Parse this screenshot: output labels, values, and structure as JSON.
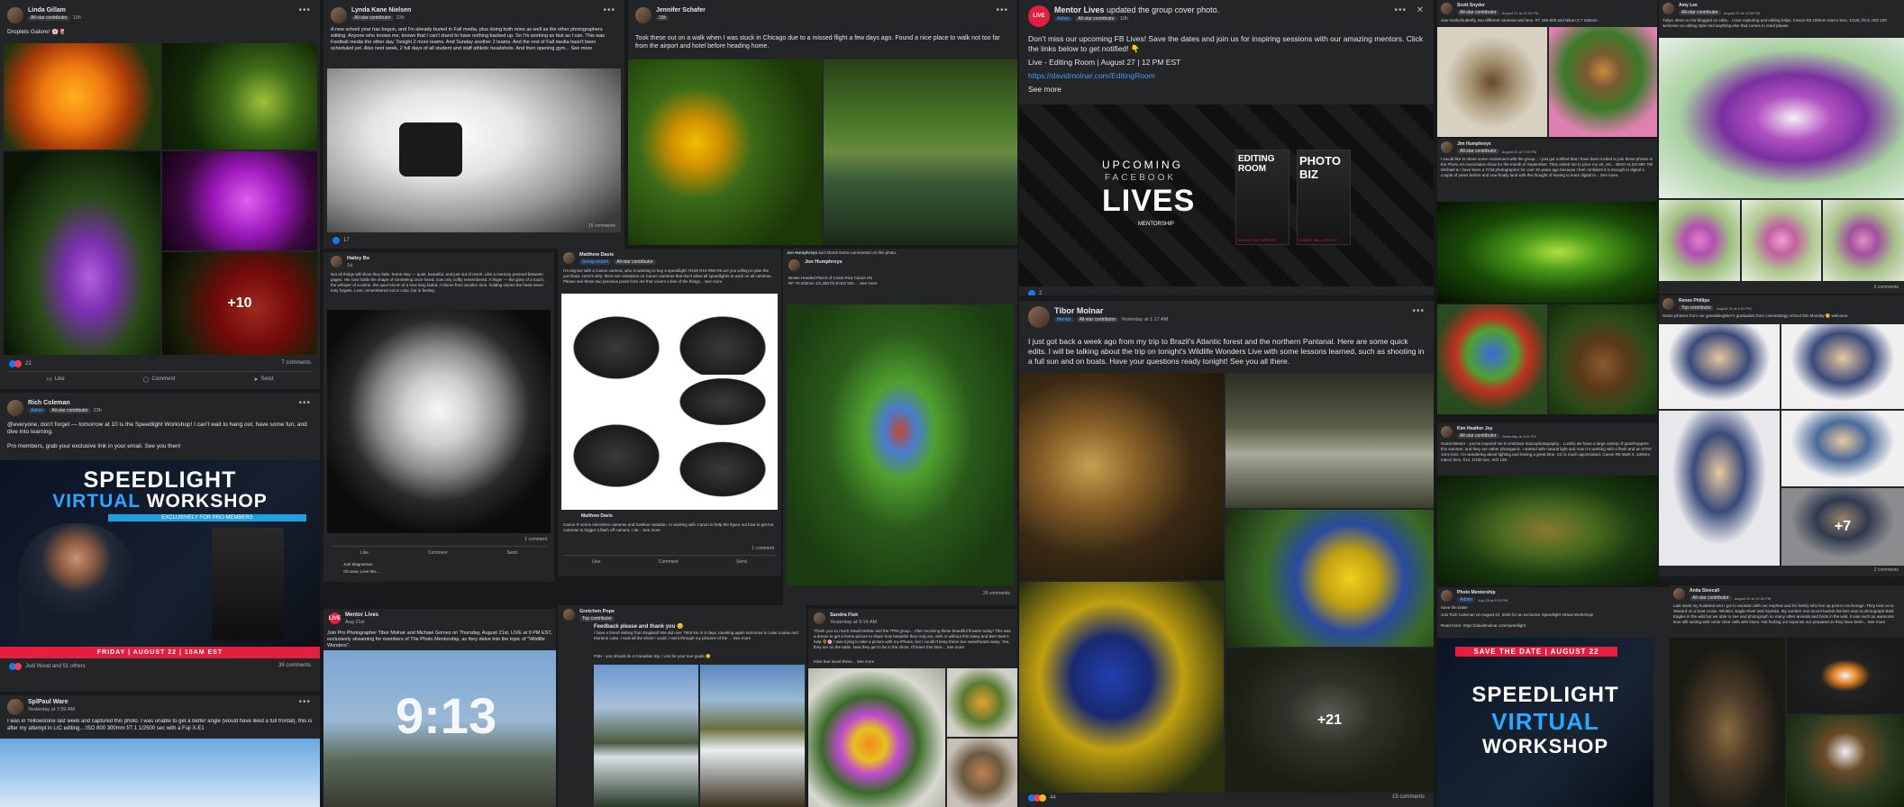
{
  "p1": {
    "name": "Linda Gillam",
    "badge": "All-star contributor",
    "time": "13h",
    "text": "Droplets Galore! 🌸🌷",
    "more": "+10",
    "reactions": "22",
    "comments": "7 comments",
    "like": "Like",
    "comment": "Comment",
    "send": "Send"
  },
  "p2": {
    "name": "Rich Coleman",
    "badge1": "Admin",
    "badge2": "All-star contributor",
    "time": "23h",
    "text1": "@everyone, don't forget — tomorrow at 10 is the Speedlight Workshop! I can't wait to hang out, have some fun, and dive into learning.",
    "text2": "Pro members, grab your exclusive link in your email. See you then!",
    "banner_l1": "SPEEDLIGHT",
    "banner_l2a": "VIRTUAL",
    "banner_l2b": "WORKSHOP",
    "banner_sub": "EXCLUSIVELY FOR PRO MEMBERS",
    "banner_date": "FRIDAY | AUGUST 22 | 10AM EST",
    "reactions": "Jodi Wood and 51 others",
    "comments": "38 comments"
  },
  "p3": {
    "name": "SplPaul Ware",
    "time": "Yesterday at 7:00 AM",
    "text": "I was in Yellowstone last week and captured this photo. I was unable to get a better angle (would have liked a full frontal), this is after my attempt in LrC editing... ISO 800 300mm f/7.1 1/2500 sec with a Fuji X-E1"
  },
  "p4": {
    "name": "Lynda Kane Nielsen",
    "badge": "All-star contributor",
    "time": "23h",
    "text": "A new school year has begun, and I'm already buried in Fall media, plus doing both mine as well as the other photographers editing. Anyone who knows me, knows that I can't stand to have nothing backed up. So I'm working as fast as I can. This was Football media the other day. Tonight 2 more teams. And Sunday another 2 teams. And the rest of Fall media hasn't been scheduled yet. Also next week, 2 full days of all student and staff athletic headshots. And then opening gym... See more",
    "comments": "15 comments",
    "reactions": "17"
  },
  "p5": {
    "name": "Hailey Bo",
    "time": "1d",
    "text": "Not all things will show they fade. Some stay — quiet, beautiful, and just out of reach. Like a memory pressed between pages. His rose holds the shape of something once loved, now only softly remembered. A finger — the glory of a touch, the whisper of a name, the quiet bloom of a love long faded. A bloom from another time, holding stories the heart never truly forgets. Love, remembered not in color, but in feeling.",
    "reactions": "",
    "comments": "1 comment",
    "commenter": "Joel Magnesson",
    "comment_text": "Oh wow, Love this..."
  },
  "p6": {
    "name": "Matthew Davis",
    "badge1": "Group expert",
    "badge2": "All-star contributor",
    "text": "I'm anyone with a Canon camera, who is wanting to buy a speedlight: R100 R10 R50 R8 are you willing to plan the purchase. Here's why: there are variations on Canon cameras that don't allow all speedlights to work on all cameras. Please see these two previous posts from me that covers a few of the things... See more",
    "sub_name": "Matthew Davis",
    "sub_text": "Canon R series mirrorless cameras and hotshoe variation. In working with Canon to help the figure out how to get hot cameras to trigger a flash off camera, I de... See more",
    "reactions": "",
    "comments": "1 comment"
  },
  "p7": {
    "name": "Jennifer Schafer",
    "time": "15h",
    "text": "Took these out on a walk when I was stuck in Chicago due to a missed flight a few days ago. Found a nice place to walk not too far from the airport and hotel before heading home."
  },
  "p8": {
    "name": "Jon Humphreys",
    "sub": "and Shorts Dena commented on this photo.",
    "sub_name": "Jon Humphreys",
    "text": "Brown Headed Parrot of Costa Rica Canon R5 RF 70-200mm 1/1,250 f/2.8 ISO 500 ... See more",
    "reactions": "",
    "comments": "26 comments"
  },
  "p9": {
    "name": "Mentor Lives",
    "time": "Aug 21st",
    "text": "Join Pro Photographer Tibor Molnar and Michael Gomez on Thursday, August 21st, LIVE at 9 PM EST, exclusively streaming for members of The Photo Mentorship, as they delve into the topic of \"Wildlife Wonders\".",
    "big_num": "9:13"
  },
  "p10": {
    "name": "Gretchen Pope",
    "time": "Top contributor",
    "title": "Feedback please and thank you 😊",
    "text": "I have a friend visiting from England! We did over 7000 km in 8 days, traveling again tomorrow to Lake Louise and Moraine Lake. I took all the shots I could. I went through my pictures of the ... See more",
    "text2": "FNH - you should do a Canadian trip, I can be your tour guide 😊"
  },
  "p11": {
    "name": "Sandra Fisk",
    "time": "Yesterday at 9:14 AM",
    "text": "Thank you so much David Molnar and the TPM group... After receiving these beautiful flowers today! This was a dream to get a home picture to share how beautiful they truly are, with or without this Daisy and Bert Sam's help 🌻🌸 I was trying to take a picture with my iPhone, but I couldn't keep these two sweethearts away. Yes, they are on the table. Now they get to be in the shots. I'll leave this here... See more",
    "sub": "Miss Sue loved these... See more"
  },
  "p12": {
    "name": "Mentor Lives",
    "sub": "updated the group cover photo.",
    "badge1": "Admin",
    "badge2": "All-star contributor",
    "time": "10h",
    "text": "Don't miss our upcoming FB Lives! Save the dates and join us for inspiring sessions with our amazing mentors. Click the links below to get notified! 👇",
    "line2": "Live - Editing Room | August 27 | 12 PM EST",
    "link": "https://davidmolnar.com/EditingRoom",
    "see_more": "See more",
    "banner_t1": "UPCOMING",
    "banner_t2": "FACEBOOK",
    "banner_t3": "LIVES",
    "banner_sub": "MENTORSHIP",
    "card1a": "EDITING",
    "card1b": "ROOM",
    "card1c": "AUGUST 27th | 12PM EST",
    "card2a": "PHOTO",
    "card2b": "BIZ",
    "card2c": "AUGUST 28th | 12PM EST",
    "reactions": "2"
  },
  "p13": {
    "name": "Tibor Molnar",
    "badge1": "Mentor",
    "badge2": "All-star contributor",
    "time": "Yesterday at 1:17 AM",
    "text": "I just got back a week ago from my trip to Brazil's Atlantic forest and the northern Pantanal. Here are some quick edits. I will be talking about the trip on tonight's Wildlife Wonders Live with some lessons learned, such as shooting in a full sun and on boats. Have your questions ready tonight! See you all there.",
    "more": "+21",
    "reactions": "44",
    "comments": "15 comments"
  },
  "p14": {
    "name": "Scott Snyder",
    "badge": "All-star contributor",
    "time": "August 21 at 10:03 PM",
    "text": "saw moths/butterfly, two different cameras and lens. R7 180-600 and Nikon Z 7 105mm."
  },
  "p15": {
    "name": "Jim Humphreys",
    "badge": "All-star contributor",
    "time": "August 20 at 7:00 PM",
    "text": "I would like to share some excitement with the group... I just got notified that I have been invited to join these photos in the Photo Art Association show for the month of September. They asked me to price my art, etc... WHO ALSO ME! Tell Michael & I have been a TCM photographer for over 20 years ago because I feel confident it is enough to digital a couple of years before and now finally land with the thought of having to learn digital in... See more"
  },
  "p16": {
    "name": "Kim Heather Joy",
    "badge": "All-star contributor",
    "time": "Yesterday at 4:09 PM",
    "text": "Guest Mentor - you've inspired me to embrace macrophotography... Luckily we have a large variety of grasshoppers this summer, and they are rather photogenic. I started with natural light and now I'm working with a flash and an STAV 1mm lens. I'm wondering about lighting and having a great time. CC is much appreciated. Canon R5 Mark II, 100mm macro lens, f/14, 1/100 sec, ISO 125"
  },
  "p17": {
    "name": "Photo Mentorship",
    "badge": "Admin",
    "time": "July 25 at 9:23 PM",
    "text": "Save the Date!",
    "text2": "Join Rich Coleman on August 22, 2025 for an exclusive Speedlight Virtual Workshop!",
    "text3": "Read more: https://davidmolnar.com/speedlight",
    "banner_top": "SAVE THE DATE | AUGUST 22",
    "banner_l1": "SPEEDLIGHT",
    "banner_l2": "VIRTUAL",
    "banner_l3": "WORKSHOP"
  },
  "p18": {
    "name": "Amy Lee",
    "badge": "All-star contributor",
    "time": "August 20 at 11:58 PM",
    "text": "Tulips. Been so far-blogged on edits... I love capturing and editing tulips. Canon R5 100mm macro lens, 1/125, f/2.8, ISO 100 welcome on editing style and anything else that comes to mind please.",
    "comments": "6 comments"
  },
  "p19": {
    "name": "Renee Phillips",
    "badge": "Top contributor",
    "time": "August 20 at 1:51 PM",
    "text": "Some pictures from our granddaughter's graduation from cosmetology school this Monday ☺️ welcome.",
    "more": "+7",
    "comments": "2 comments"
  },
  "p20": {
    "name": "Anita Stoecall",
    "badge": "All-star contributor",
    "time": "August 20 at 12:04 PM",
    "text": "Last week my husband and I got to vacation with our nephew and his family who live up post in Anchorage. They took us to Seward on a boat cruise. Whittier, Eagle River and Alyeska. My number one recent bucket list item was to photograph Bald Eagles in the wild but we able to see and photograph so many other animals and birds in the wild. It was such an awesome time still raining with some clear calls with blues. Not hurting our expense our prepared so they have been... See more"
  }
}
